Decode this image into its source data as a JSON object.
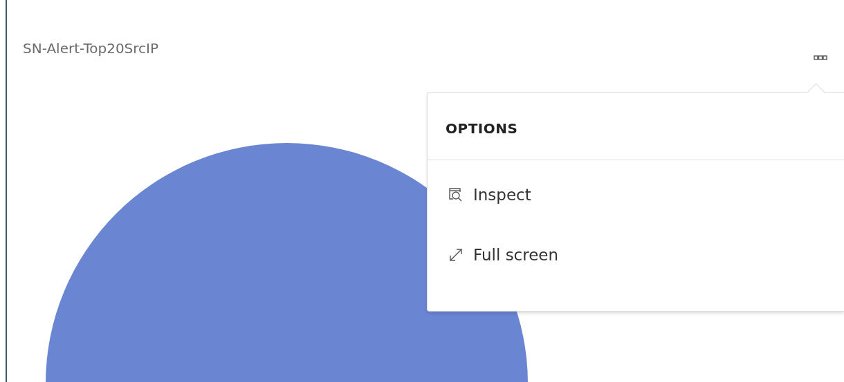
{
  "panel": {
    "title": "SN-Alert-Top20SrcIP",
    "options_open": true
  },
  "options_menu": {
    "title": "OPTIONS",
    "items": [
      {
        "label": "Inspect",
        "kind": "inspect"
      },
      {
        "label": "Full screen",
        "kind": "fullscreen"
      }
    ]
  }
}
